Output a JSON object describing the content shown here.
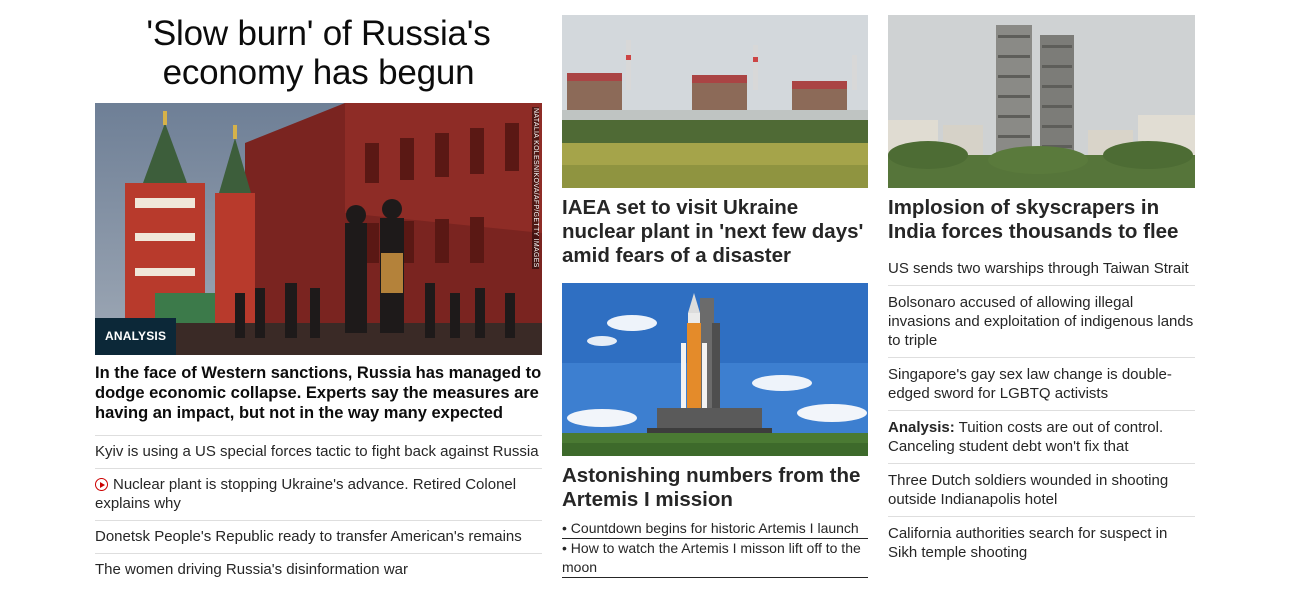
{
  "col1": {
    "headline": "'Slow burn' of Russia's economy has begun",
    "image_alt": "Red brick buildings near Red Square with pedestrians walking",
    "badge": "ANALYSIS",
    "credit": "NATALIA KOLESNIKOVA/AFP/GETTY IMAGES",
    "description": "In the face of Western sanctions, Russia has managed to dodge economic collapse. Experts say the measures are having an impact, but not in the way many expected",
    "links": [
      {
        "text": "Kyiv is using a US special forces tactic to fight back against Russia",
        "icon": ""
      },
      {
        "text": "Nuclear plant is stopping Ukraine's advance. Retired Colonel explains why",
        "icon": "play-icon"
      },
      {
        "text": "Donetsk People's Republic ready to transfer American's remains",
        "icon": ""
      },
      {
        "text": "The women driving Russia's disinformation war",
        "icon": ""
      }
    ]
  },
  "col2": {
    "card1": {
      "image_alt": "Nuclear power plant buildings behind green field",
      "title": "IAEA set to visit Ukraine nuclear plant in 'next few days' amid fears of a disaster"
    },
    "card2": {
      "image_alt": "Artemis I rocket on launch pad under blue sky",
      "title": "Astonishing numbers from the Artemis I mission",
      "bullets": [
        "• Countdown begins for historic Artemis I launch",
        "• How to watch the Artemis I misson lift off to the moon"
      ]
    }
  },
  "col3": {
    "card": {
      "image_alt": "Twin skyscrapers under construction in India",
      "title": "Implosion of skyscrapers in India forces thousands to flee"
    },
    "links": [
      {
        "kicker": "",
        "text": "US sends two warships through Taiwan Strait"
      },
      {
        "kicker": "",
        "text": "Bolsonaro accused of allowing illegal invasions and exploitation of indigenous lands to triple"
      },
      {
        "kicker": "",
        "text": "Singapore's gay sex law change is double-edged sword for LGBTQ activists"
      },
      {
        "kicker": "Analysis:",
        "text": " Tuition costs are out of control. Canceling student debt won't fix that"
      },
      {
        "kicker": "",
        "text": "Three Dutch soldiers wounded in shooting outside Indianapolis hotel"
      },
      {
        "kicker": "",
        "text": "California authorities search for suspect in Sikh temple shooting"
      }
    ]
  }
}
